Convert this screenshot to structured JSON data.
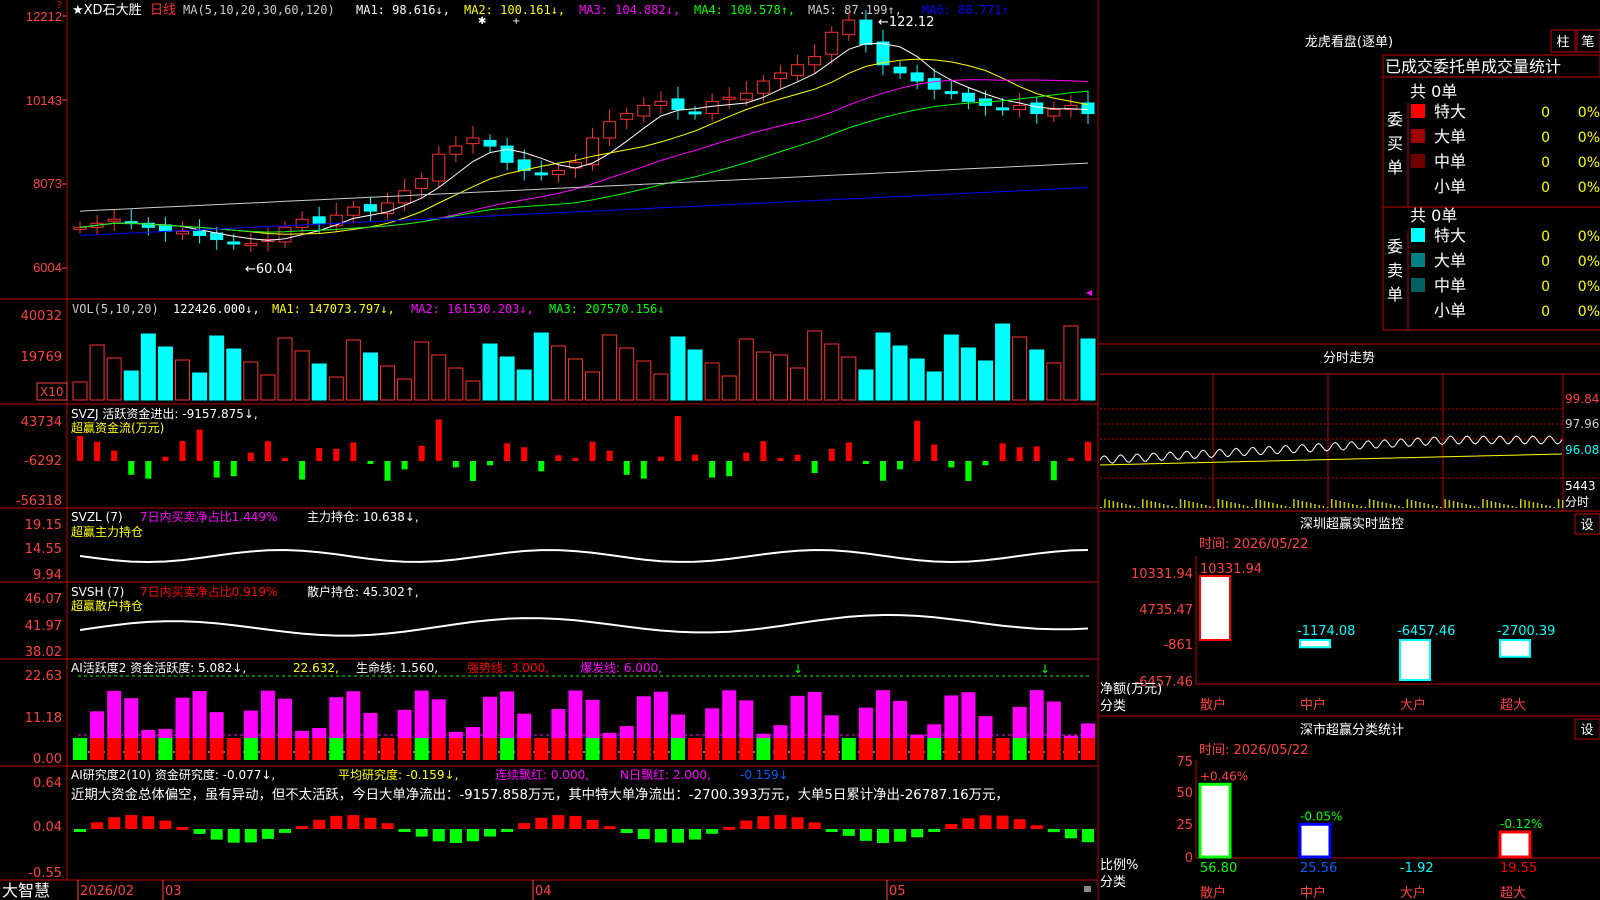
{
  "header": {
    "symbol": "★XD石大胜",
    "period": "日线",
    "ma_params": "MA(5,10,20,30,60,120)",
    "ma_items": [
      {
        "label": "MA1: 98.616↓,",
        "color": "#ffffff"
      },
      {
        "label": "MA2: 100.161↓,",
        "color": "#ffff00"
      },
      {
        "label": "MA3: 104.882↓,",
        "color": "#ff00ff"
      },
      {
        "label": "MA4: 100.578↑,",
        "color": "#00ff00"
      },
      {
        "label": "MA5: 87.199↑,",
        "color": "#cccccc"
      },
      {
        "label": "MA6: 80.771↑",
        "color": "#0000ff"
      }
    ]
  },
  "price_axis": [
    "12212",
    "10143",
    "8073",
    "6004"
  ],
  "price_annotations": {
    "high": "122.12",
    "low": "60.04"
  },
  "vol_panel": {
    "title": "VOL(5,10,20)",
    "value": "122426.000↓,",
    "ma1": "MA1: 147073.797↓,",
    "ma2": "MA2: 161530.203↓,",
    "ma3": "MA3: 207570.156↓",
    "axis": [
      "40032",
      "19769"
    ],
    "unit": "X10"
  },
  "svzj_panel": {
    "title": "SVZJ  活跃资金进出: -9157.875↓,",
    "subtitle": "超赢资金流(万元)",
    "axis": [
      "43734",
      "-6292",
      "-56318"
    ]
  },
  "svzl_panel": {
    "title": "SVZL (7)",
    "part1": "7日内买卖净占比1.449%",
    "part2": "主力持仓: 10.638↓,",
    "subtitle": "超赢主力持仓",
    "axis": [
      "19.15",
      "14.55",
      "9.94"
    ]
  },
  "svsh_panel": {
    "title": "SVSH (7)",
    "part1": "7日内买卖净占比0.919%",
    "part2": "散户持仓: 45.302↑,",
    "subtitle": "超赢散户持仓",
    "axis": [
      "46.07",
      "41.97",
      "38.02"
    ]
  },
  "ai_active_panel": {
    "title": "AI活跃度2 资金活跃度: 5.082↓,",
    "v2": "22.632,",
    "v3": "生命线: 1.560,",
    "v4": "强势线: 3.000,",
    "v5": "爆发线: 6.000,",
    "axis": [
      "22.63",
      "11.18",
      "0.00"
    ]
  },
  "ai_research_panel": {
    "title": "AI研究度2(10) 资金研究度: -0.077↓,",
    "avg": "平均研究度: -0.159↓,",
    "red": "连续飘红: 0.000,",
    "nred": "N日飘红: 2.000,",
    "last": "-0.159↓",
    "note": "近期大资金总体偏空，虽有异动，但不太活跃，今日大单净流出：-9157.858万元，其中特大单净流出：-2700.393万元，大单5日累计净出-26787.16万元，",
    "axis": [
      "0.64",
      "0.04",
      "-0.55"
    ]
  },
  "bottom_bar": {
    "brand": "大智慧",
    "dates": [
      "2026/02",
      "03",
      "04",
      "05"
    ]
  },
  "right_panel": {
    "top_title": "龙虎看盘(逐单)",
    "top_btns": [
      "柱",
      "笔"
    ],
    "tabs": "已成交委托单成交量统计",
    "buy": {
      "total": "共 0单",
      "label": "委买单",
      "rows": [
        {
          "name": "特大",
          "count": "0",
          "pct": "0%",
          "color": "#ff0000"
        },
        {
          "name": "大单",
          "count": "0",
          "pct": "0%",
          "color": "#a00000"
        },
        {
          "name": "中单",
          "count": "0",
          "pct": "0%",
          "color": "#700000"
        },
        {
          "name": "小单",
          "count": "0",
          "pct": "0%",
          "color": "#000000"
        }
      ]
    },
    "sell": {
      "total": "共 0单",
      "label": "委卖单",
      "rows": [
        {
          "name": "特大",
          "count": "0",
          "pct": "0%",
          "color": "#00ffff"
        },
        {
          "name": "大单",
          "count": "0",
          "pct": "0%",
          "color": "#008080"
        },
        {
          "name": "中单",
          "count": "0",
          "pct": "0%",
          "color": "#006060"
        },
        {
          "name": "小单",
          "count": "0",
          "pct": "0%",
          "color": "#000000"
        }
      ]
    },
    "intraday": {
      "title": "分时走势",
      "axis": [
        "99.84",
        "97.96",
        "96.08",
        "5443",
        "分时"
      ]
    },
    "monitor": {
      "title": "深圳超赢实时监控",
      "btn": "设",
      "time": "时间: 2026/05/22",
      "axis": [
        "10331.94",
        "4735.47",
        "-861",
        "-6457.46"
      ],
      "unit": "净额(万元)",
      "cat": "分类",
      "bars": [
        {
          "name": "散户",
          "value": 10331.94,
          "label": "10331.94"
        },
        {
          "name": "中户",
          "value": -1174.08,
          "label": "-1174.08"
        },
        {
          "name": "大户",
          "value": -6457.46,
          "label": "-6457.46"
        },
        {
          "name": "超大",
          "value": -2700.39,
          "label": "-2700.39"
        }
      ]
    },
    "classify": {
      "title": "深市超赢分类统计",
      "btn": "设",
      "time": "时间: 2026/05/22",
      "axis": [
        "75",
        "50",
        "25",
        "0"
      ],
      "unit": "比例%",
      "cat": "分类",
      "bars": [
        {
          "name": "散户",
          "value": 56.8,
          "label": "56.80",
          "delta": "+0.46%"
        },
        {
          "name": "中户",
          "value": 25.56,
          "label": "25.56",
          "delta": "-0.05%"
        },
        {
          "name": "大户",
          "value": -1.92,
          "label": "-1.92",
          "delta": ""
        },
        {
          "name": "超大",
          "value": 19.55,
          "label": "19.55",
          "delta": "-0.12%"
        }
      ]
    }
  }
}
